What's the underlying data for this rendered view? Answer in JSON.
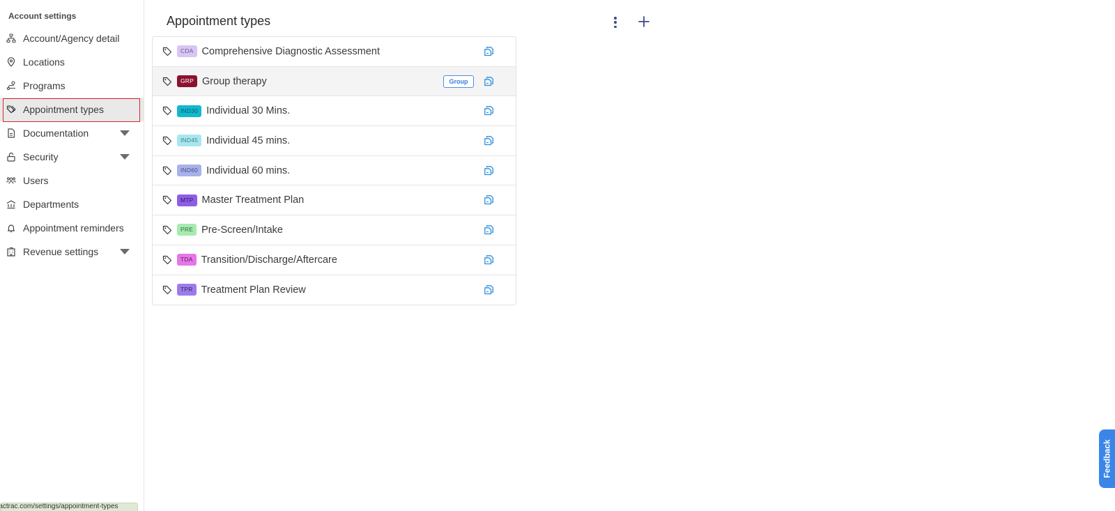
{
  "sidebar": {
    "heading": "Account settings",
    "items": [
      {
        "label": "Account/Agency detail",
        "icon": "sitemap-icon",
        "has_caret": false,
        "active": false
      },
      {
        "label": "Locations",
        "icon": "location-pin-icon",
        "has_caret": false,
        "active": false
      },
      {
        "label": "Programs",
        "icon": "route-icon",
        "has_caret": false,
        "active": false
      },
      {
        "label": "Appointment types",
        "icon": "tags-icon",
        "has_caret": false,
        "active": true
      },
      {
        "label": "Documentation",
        "icon": "document-icon",
        "has_caret": true,
        "active": false
      },
      {
        "label": "Security",
        "icon": "unlock-icon",
        "has_caret": true,
        "active": false
      },
      {
        "label": "Users",
        "icon": "users-icon",
        "has_caret": false,
        "active": false
      },
      {
        "label": "Departments",
        "icon": "building-columns-icon",
        "has_caret": false,
        "active": false
      },
      {
        "label": "Appointment reminders",
        "icon": "bell-icon",
        "has_caret": false,
        "active": false
      },
      {
        "label": "Revenue settings",
        "icon": "building-icon",
        "has_caret": true,
        "active": false
      }
    ],
    "status_url": "ractrac.com/settings/appointment-types"
  },
  "main": {
    "title": "Appointment types",
    "appointment_types": [
      {
        "code": "CDA",
        "name": "Comprehensive Diagnostic Assessment",
        "badge_bg": "#d7c6f3",
        "badge_fg": "#6b5a8c",
        "group": ""
      },
      {
        "code": "GRP",
        "name": "Group therapy",
        "badge_bg": "#8b1130",
        "badge_fg": "#ffffff",
        "group": "Group"
      },
      {
        "code": "IND30",
        "name": "Individual 30 Mins.",
        "badge_bg": "#12b8cf",
        "badge_fg": "#0b5b66",
        "group": ""
      },
      {
        "code": "IND45",
        "name": "Individual 45 mins.",
        "badge_bg": "#a8e7f0",
        "badge_fg": "#3f7d87",
        "group": ""
      },
      {
        "code": "IND60",
        "name": "Individual 60 mins.",
        "badge_bg": "#a9b1ea",
        "badge_fg": "#4a4f85",
        "group": ""
      },
      {
        "code": "MTP",
        "name": "Master Treatment Plan",
        "badge_bg": "#8e5de6",
        "badge_fg": "#2d1a55",
        "group": ""
      },
      {
        "code": "PRE",
        "name": "Pre-Screen/Intake",
        "badge_bg": "#a6eab0",
        "badge_fg": "#2f6b3a",
        "group": ""
      },
      {
        "code": "TDA",
        "name": "Transition/Discharge/Aftercare",
        "badge_bg": "#e676e8",
        "badge_fg": "#5a1c5c",
        "group": ""
      },
      {
        "code": "TPR",
        "name": "Treatment Plan Review",
        "badge_bg": "#9e7bea",
        "badge_fg": "#2f1f57",
        "group": ""
      }
    ]
  },
  "feedback": {
    "label": "Feedback"
  },
  "colors": {
    "accent": "#3f4a8a",
    "active_outline": "#d9262c",
    "copy_icon": "#2d8fdf",
    "feedback_bg": "#3a86e8"
  }
}
